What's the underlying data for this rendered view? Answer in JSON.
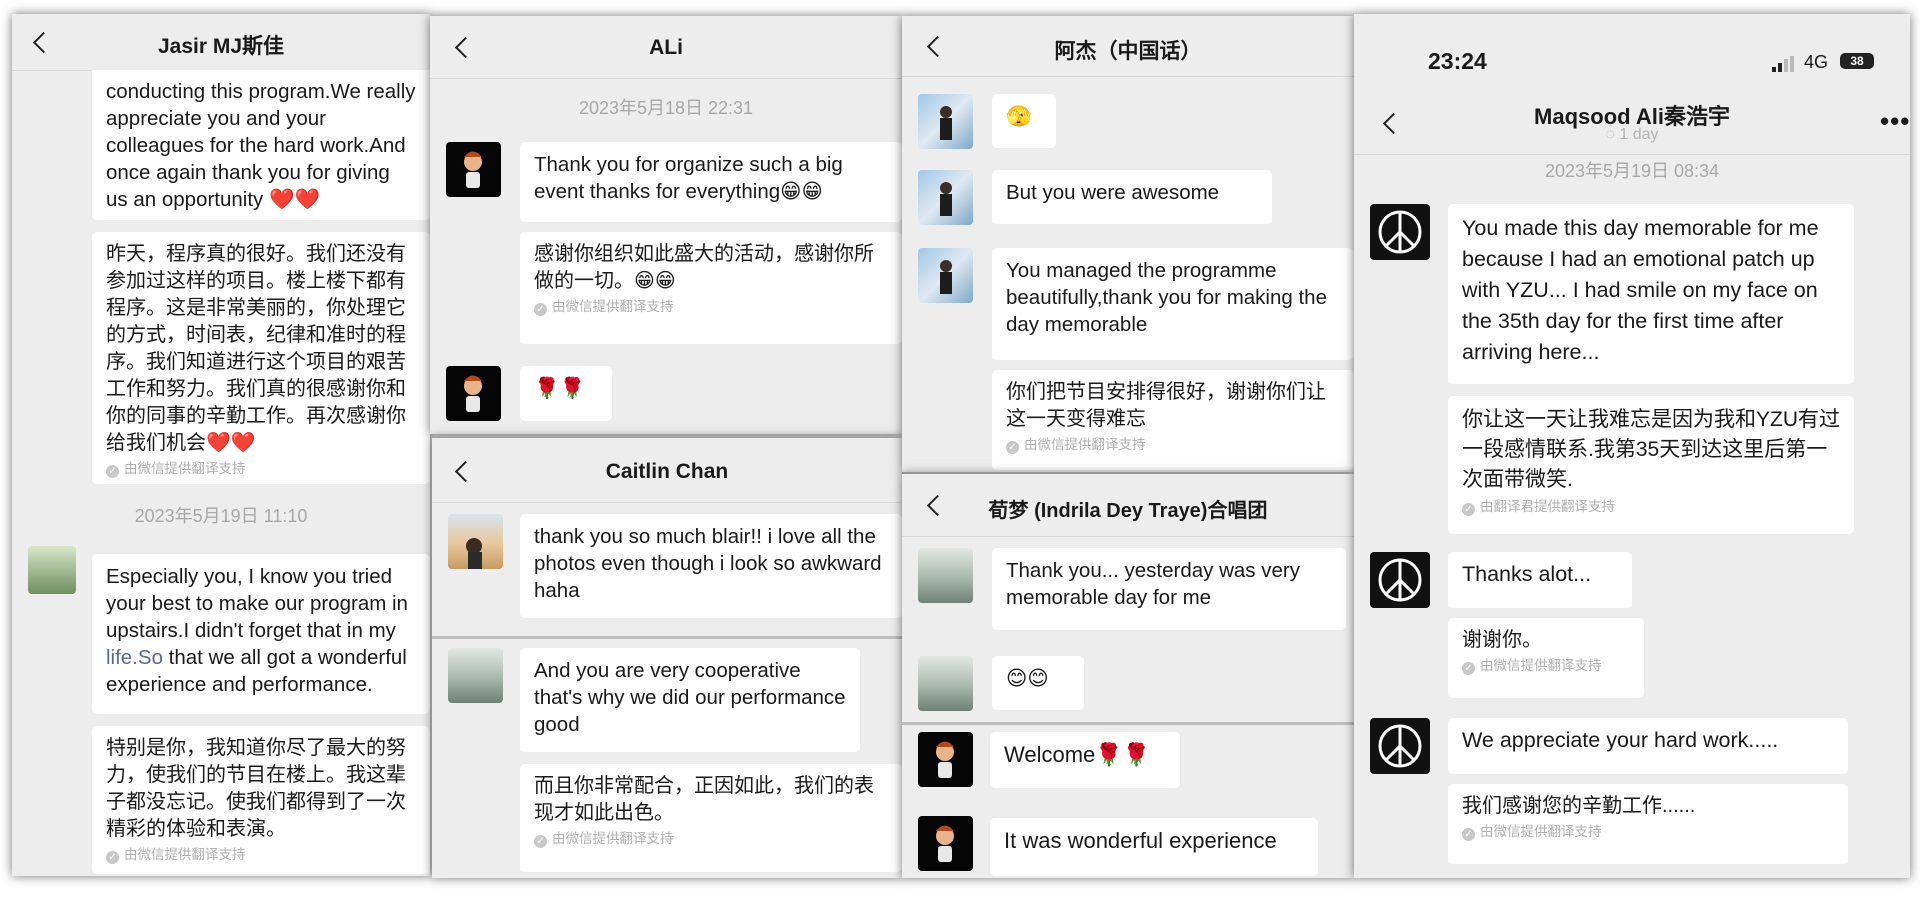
{
  "colors": {
    "background": "#ededed",
    "bubble": "#ffffff",
    "link": "#576b95",
    "timestamp": "#a8a8a8"
  },
  "translate_note": "由微信提供翻译支持",
  "translate_note_alt": "由翻译君提供翻译支持",
  "panel1": {
    "title": "Jasir MJ斯佳",
    "msg1": "conducting this program.We really appreciate you and your colleagues for the hard work.And once again thank you for giving us an opportunity ❤️❤️",
    "msg2": "昨天，程序真的很好。我们还没有参加过这样的项目。楼上楼下都有程序。这是非常美丽的，你处理它的方式，时间表，纪律和准时的程序。我们知道进行这个项目的艰苦工作和努力。我们真的很感谢你和你的同事的辛勤工作。再次感谢你给我们机会❤️❤️",
    "timestamp": "2023年5月19日 11:10",
    "msg3_part1": "Especially you, I know you tried your best to make our program in upstairs.I didn't forget that in my ",
    "msg3_link": "life.So",
    "msg3_part2": " that we all got a wonderful experience and performance.",
    "msg4": "特别是你，我知道你尽了最大的努力，使我们的节目在楼上。我这辈子都没忘记。使我们都得到了一次精彩的体验和表演。"
  },
  "panel2": {
    "title": "ALi",
    "timestamp": "2023年5月18日 22:31",
    "msg1": "Thank you for organize such a big event thanks for everything😁😁",
    "msg2": "感谢你组织如此盛大的活动，感谢你所做的一切。😁😁",
    "msg3": "🌹🌹"
  },
  "panel3": {
    "title": "Caitlin Chan",
    "msg1": "thank you so much blair!! i love all the photos even though i look so awkward haha",
    "msg2": "And you are very cooperative that's why we did our performance good",
    "msg3": "而且你非常配合，正因如此，我们的表现才如此出色。"
  },
  "panel4": {
    "title": "阿杰（中国话）",
    "msg1": "🫣",
    "msg2": "But you were awesome",
    "msg3": "You managed the programme beautifully,thank you for making the day memorable",
    "msg4": "你们把节目安排得很好，谢谢你们让这一天变得难忘"
  },
  "panel5": {
    "title": "荀梦 (Indrila Dey Traye)合唱团",
    "msg1": "Thank you... yesterday was very memorable day for me",
    "msg2": "😊😊",
    "msg3": "Welcome🌹🌹",
    "msg4": "It was wonderful experience"
  },
  "panel6": {
    "status_time": "23:24",
    "status_network": "4G",
    "battery": "38",
    "title": "Maqsood Ali秦浩宇",
    "subtitle": "1 day",
    "timestamp": "2023年5月19日 08:34",
    "msg1": "You made this day memorable for me because I had an emotional patch up with YZU... I had smile on my face on the 35th day for the first time after arriving here...",
    "msg2": "你让这一天让我难忘是因为我和YZU有过一段感情联系.我第35天到达这里后第一次面带微笑.",
    "msg3": "Thanks alot...",
    "msg4": "谢谢你。",
    "msg5": "We appreciate your hard work.....",
    "msg6": "我们感谢您的辛勤工作......"
  }
}
